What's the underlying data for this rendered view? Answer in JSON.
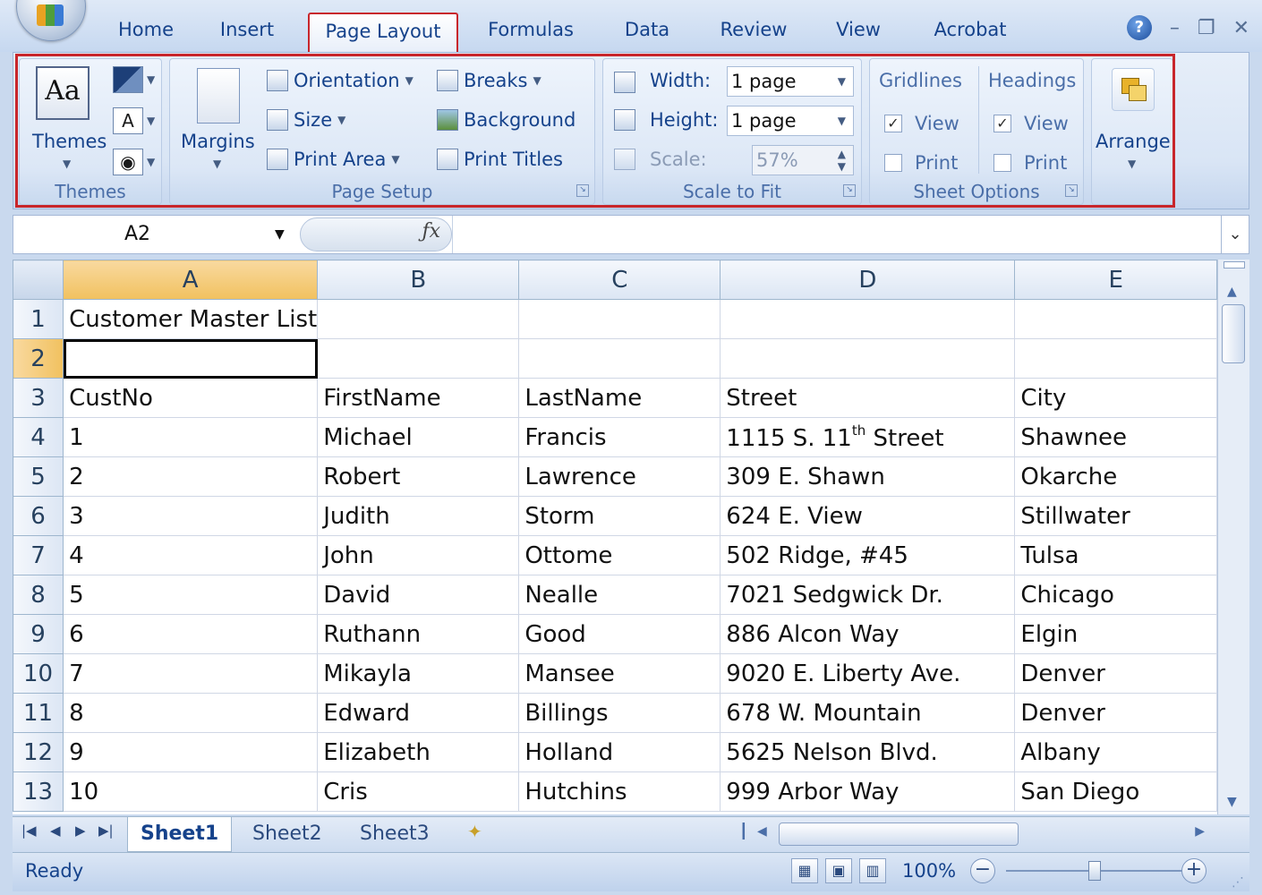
{
  "ribbon_tabs": [
    "Home",
    "Insert",
    "Page Layout",
    "Formulas",
    "Data",
    "Review",
    "View",
    "Acrobat"
  ],
  "active_tab": "Page Layout",
  "ribbon": {
    "themes": {
      "label": "Themes",
      "group_label": "Themes"
    },
    "page_setup": {
      "group_label": "Page Setup",
      "margins": "Margins",
      "orientation": "Orientation",
      "size": "Size",
      "print_area": "Print Area",
      "breaks": "Breaks",
      "background": "Background",
      "print_titles": "Print Titles"
    },
    "scale_to_fit": {
      "group_label": "Scale to Fit",
      "width_label": "Width:",
      "width_value": "1 page",
      "height_label": "Height:",
      "height_value": "1 page",
      "scale_label": "Scale:",
      "scale_value": "57%"
    },
    "sheet_options": {
      "group_label": "Sheet Options",
      "gridlines": "Gridlines",
      "headings": "Headings",
      "view": "View",
      "print": "Print",
      "gridlines_view_checked": true,
      "gridlines_print_checked": false,
      "headings_view_checked": true,
      "headings_print_checked": false
    },
    "arrange": {
      "label": "Arrange"
    }
  },
  "formula_bar": {
    "name_box": "A2",
    "fx": "fx",
    "formula": ""
  },
  "grid": {
    "columns": [
      "A",
      "B",
      "C",
      "D",
      "E"
    ],
    "selected_column": "A",
    "selected_row": "2",
    "active_cell": "A2",
    "rows": [
      {
        "num": "1",
        "cells": [
          "Customer Master List",
          "",
          "",
          "",
          ""
        ]
      },
      {
        "num": "2",
        "cells": [
          "",
          "",
          "",
          "",
          ""
        ]
      },
      {
        "num": "3",
        "cells": [
          "CustNo",
          "FirstName",
          "LastName",
          "Street",
          "City"
        ]
      },
      {
        "num": "4",
        "cells": [
          "1",
          "Michael",
          "Francis",
          "1115 S. 11th Street",
          "Shawnee"
        ]
      },
      {
        "num": "5",
        "cells": [
          "2",
          "Robert",
          "Lawrence",
          "309 E. Shawn",
          "Okarche"
        ]
      },
      {
        "num": "6",
        "cells": [
          "3",
          "Judith",
          "Storm",
          "624 E. View",
          "Stillwater"
        ]
      },
      {
        "num": "7",
        "cells": [
          "4",
          "John",
          "Ottome",
          "502 Ridge, #45",
          "Tulsa"
        ]
      },
      {
        "num": "8",
        "cells": [
          "5",
          "David",
          "Nealle",
          "7021 Sedgwick Dr.",
          "Chicago"
        ]
      },
      {
        "num": "9",
        "cells": [
          "6",
          "Ruthann",
          "Good",
          "886 Alcon Way",
          "Elgin"
        ]
      },
      {
        "num": "10",
        "cells": [
          "7",
          "Mikayla",
          "Mansee",
          "9020 E. Liberty Ave.",
          "Denver"
        ]
      },
      {
        "num": "11",
        "cells": [
          "8",
          "Edward",
          "Billings",
          "678 W. Mountain",
          "Denver"
        ]
      },
      {
        "num": "12",
        "cells": [
          "9",
          "Elizabeth",
          "Holland",
          "5625 Nelson Blvd.",
          "Albany"
        ]
      },
      {
        "num": "13",
        "cells": [
          "10",
          "Cris",
          "Hutchins",
          "999 Arbor Way",
          "San Diego"
        ]
      }
    ]
  },
  "sheet_tabs": [
    "Sheet1",
    "Sheet2",
    "Sheet3"
  ],
  "active_sheet": "Sheet1",
  "status": {
    "text": "Ready",
    "zoom": "100%",
    "zoom_fraction": 0.5
  },
  "colors": {
    "highlight": "#c8262b",
    "selected_header": "#f1c15f",
    "accent": "#15428b"
  }
}
